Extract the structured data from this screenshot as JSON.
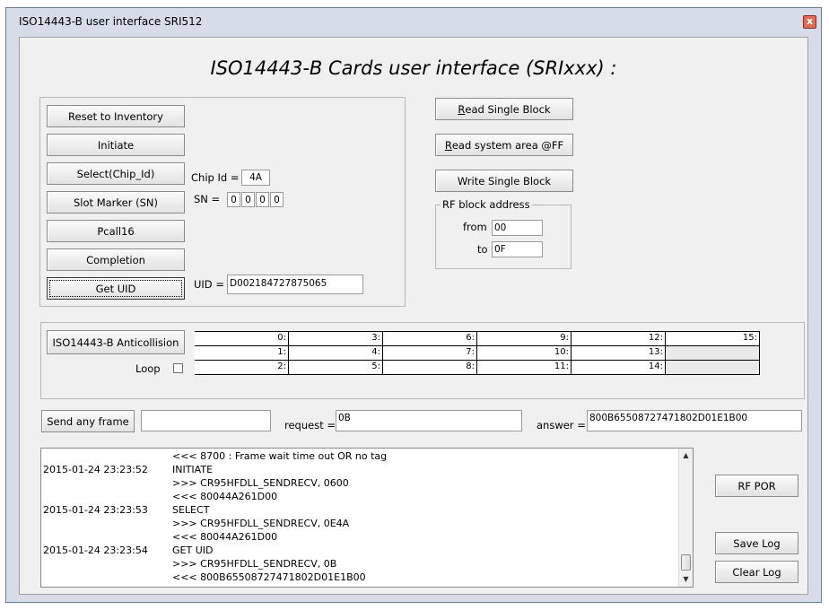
{
  "window": {
    "title": "ISO14443-B  user interface  SRI512",
    "close_glyph": "x"
  },
  "heading": "ISO14443-B Cards user interface (SRIxxx) :",
  "left_panel": {
    "buttons": {
      "reset": "Reset to Inventory",
      "initiate": "Initiate",
      "select": "Select(Chip_Id)",
      "slot_marker": "Slot Marker (SN)",
      "pcall16": "Pcall16",
      "completion": "Completion",
      "get_uid": "Get UID"
    },
    "chip_id_label": "Chip Id =",
    "chip_id_value": "4A",
    "sn_label": "SN =",
    "sn_values": [
      "0",
      "0",
      "0",
      "0"
    ],
    "uid_label": "UID =",
    "uid_value": "D002184727875065"
  },
  "right_panel": {
    "read_single_block": {
      "accel": "R",
      "rest": "ead Single Block"
    },
    "read_system_area": {
      "accel": "R",
      "rest": "ead system area @FF"
    },
    "write_single_block": "Write Single Block",
    "rf_block_group": "RF block address",
    "from_label": "from",
    "from_value": "00",
    "to_label": "to",
    "to_value": "0F"
  },
  "anticollision": {
    "button": "ISO14443-B Anticollision",
    "loop_label": "Loop",
    "slots": [
      [
        "0:",
        "3:",
        "6:",
        "9:",
        "12:",
        "15:"
      ],
      [
        "1:",
        "4:",
        "7:",
        "10:",
        "13:",
        ""
      ],
      [
        "2:",
        "5:",
        "8:",
        "11:",
        "14:",
        ""
      ]
    ]
  },
  "send_frame": {
    "button": "Send any frame",
    "frame_value": "",
    "request_label": "request =",
    "request_value": "0B",
    "answer_label": "answer =",
    "answer_value": "800B65508727471802D01E1B00"
  },
  "log": [
    {
      "ts": "",
      "msg": "<<< 8700 : Frame wait time out OR no tag"
    },
    {
      "ts": "2015-01-24 23:23:52",
      "msg": "INITIATE"
    },
    {
      "ts": "",
      "msg": ">>> CR95HFDLL_SENDRECV, 0600"
    },
    {
      "ts": "",
      "msg": "<<< 80044A261D00"
    },
    {
      "ts": "2015-01-24 23:23:53",
      "msg": "SELECT"
    },
    {
      "ts": "",
      "msg": ">>> CR95HFDLL_SENDRECV, 0E4A"
    },
    {
      "ts": "",
      "msg": "<<< 80044A261D00"
    },
    {
      "ts": "2015-01-24 23:23:54",
      "msg": "GET UID"
    },
    {
      "ts": "",
      "msg": ">>> CR95HFDLL_SENDRECV, 0B"
    },
    {
      "ts": "",
      "msg": "<<< 800B65508727471802D01E1B00"
    }
  ],
  "side_buttons": {
    "rf_por": "RF POR",
    "save_log": "Save Log",
    "clear_log": "Clear Log"
  }
}
